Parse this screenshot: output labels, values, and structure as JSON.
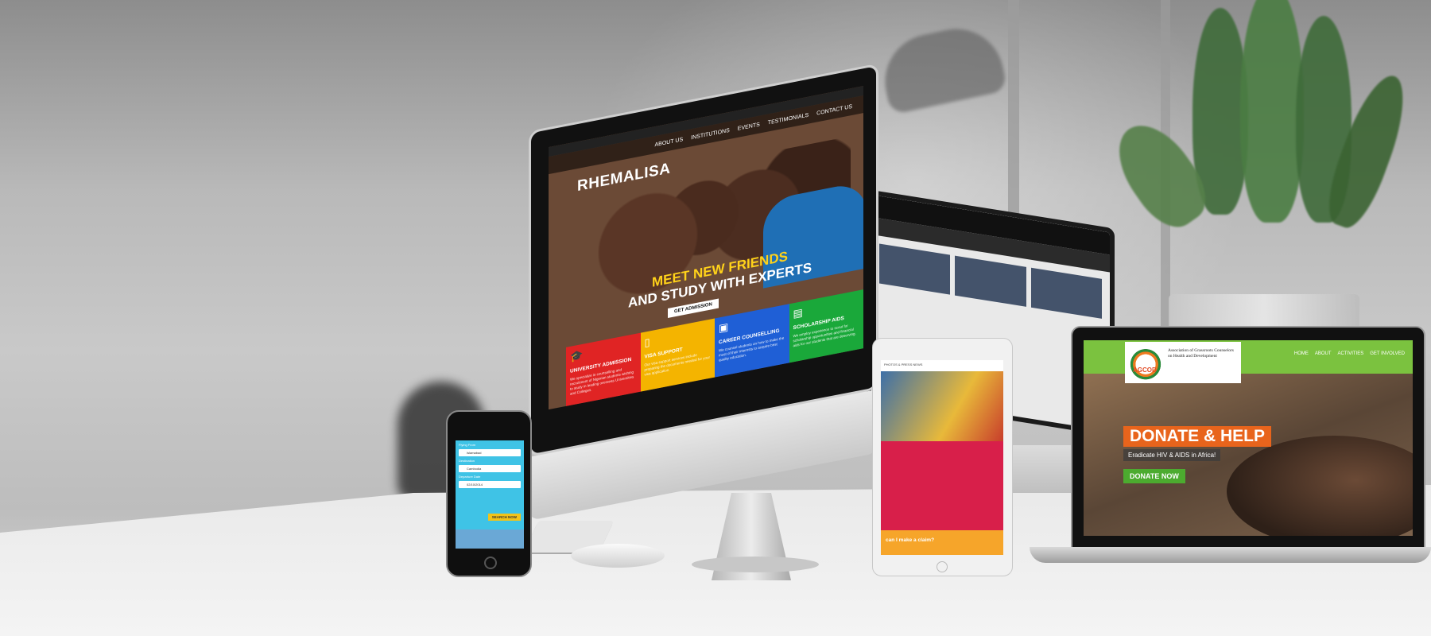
{
  "imac": {
    "logo": "RHEMALISA",
    "nav": [
      "ABOUT US",
      "INSTITUTIONS",
      "EVENTS",
      "TESTIMONIALS",
      "CONTACT US"
    ],
    "headline_line1": "MEET NEW FRIENDS",
    "headline_line2": "AND STUDY WITH EXPERTS",
    "cta_label": "GET ADMISSION",
    "tiles": [
      {
        "title": "UNIVERSITY ADMISSION",
        "icon": "graduation-cap-icon",
        "color": "#e02424",
        "body": "We specialize in counselling and recruitment of Nigerian students wishing to study in leading overseas Universities and Colleges."
      },
      {
        "title": "VISA SUPPORT",
        "icon": "passport-icon",
        "color": "#f4b400",
        "body": "Our visa support services include preparing the documents needed for your visa application."
      },
      {
        "title": "CAREER COUNSELLING",
        "icon": "presentation-icon",
        "color": "#1f5fd6",
        "body": "We counsel students on how to make the most of their interests to acquire best quality education."
      },
      {
        "title": "SCHOLARSHIP AIDS",
        "icon": "certificate-icon",
        "color": "#1aa83a",
        "body": "We employ experience to scout for scholarship opportunities and financial aids for our students that are deserving."
      }
    ]
  },
  "phone": {
    "fields": [
      {
        "label": "Flying From",
        "value": "Islamabad"
      },
      {
        "label": "Destination",
        "value": "Cambodia"
      },
      {
        "label": "Departure Date",
        "value": "02/10/2014"
      }
    ],
    "search_label": "SEARCH NOW"
  },
  "tablet": {
    "header": "PHOTOS & PRESS NEWS",
    "footer": "can I make a claim?"
  },
  "laptop": {
    "logo_short": "AGCOD",
    "logo_text": "Association of Grassroots Counselors on Health and Development",
    "nav": [
      "HOME",
      "ABOUT",
      "ACTIVITIES",
      "GET INVOLVED"
    ],
    "headline": "DONATE & HELP",
    "subline": "Eradicate HIV & AIDS in Africa!",
    "button": "DONATE NOW"
  },
  "colors": {
    "accent_orange": "#e8641c",
    "agcod_green": "#7bc23f",
    "tablet_red": "#d81f4a",
    "tablet_orange": "#f6a52a"
  }
}
